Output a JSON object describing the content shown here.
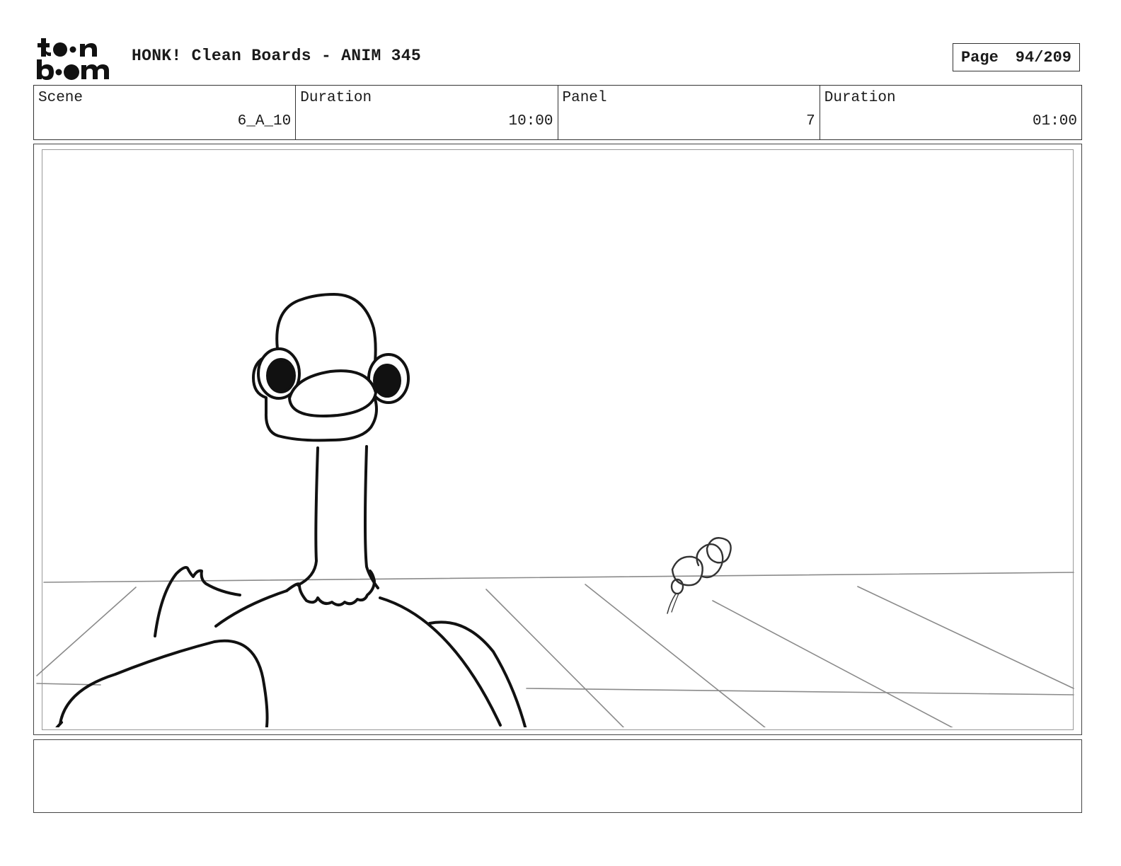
{
  "header": {
    "logo_text": "toon boom",
    "title": "HONK! Clean Boards - ANIM 345",
    "page_label": "Page",
    "page_value": "94/209"
  },
  "info": {
    "scene_label": "Scene",
    "scene_value": "6_A_10",
    "scene_duration_label": "Duration",
    "scene_duration_value": "10:00",
    "panel_label": "Panel",
    "panel_value": "7",
    "panel_duration_label": "Duration",
    "panel_duration_value": "01:00"
  },
  "panel": {
    "image_subject": "goose-drawing",
    "notes": ""
  }
}
